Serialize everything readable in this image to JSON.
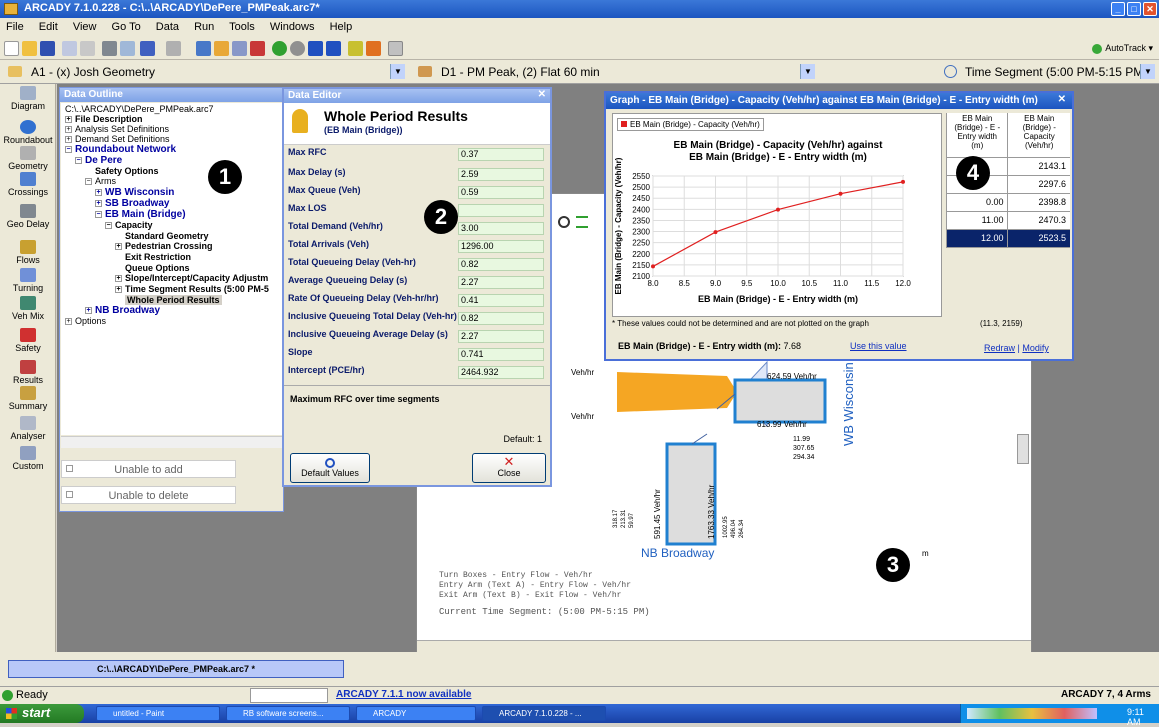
{
  "window": {
    "title": "ARCADY 7.1.0.228 - C:\\..\\ARCADY\\DePere_PMPeak.arc7*"
  },
  "menu": [
    "File",
    "Edit",
    "View",
    "Go To",
    "Data",
    "Run",
    "Tools",
    "Windows",
    "Help"
  ],
  "toolbar": {
    "autotrack": "AutoTrack"
  },
  "selectors": {
    "analysis": "A1 - (x) Josh Geometry",
    "demand": "D1 - PM Peak, (2) Flat 60 min",
    "time": "Time Segment (5:00 PM-5:15 PM)"
  },
  "leftbar": [
    "Diagram",
    "Roundabout",
    "Geometry",
    "Crossings",
    "Geo Delay",
    "Flows",
    "Turning",
    "Veh Mix",
    "Safety",
    "Results",
    "Summary",
    "Analyser",
    "Custom"
  ],
  "outline": {
    "title": "Data Outline",
    "path": "C:\\..\\ARCADY\\DePere_PMPeak.arc7",
    "items": [
      "File Description",
      "Analysis Set Definitions",
      "Demand Set Definitions",
      "Roundabout Network",
      "De Pere",
      "Safety Options",
      "Arms",
      "WB Wisconsin",
      "SB Broadway",
      "EB Main (Bridge)",
      "Capacity",
      "Standard Geometry",
      "Pedestrian Crossing",
      "Exit Restriction",
      "Queue Options",
      "Slope/Intercept/Capacity Adjustm",
      "Time Segment Results (5:00 PM-5",
      "Whole Period Results",
      "NB Broadway",
      "Options"
    ],
    "unable_add": "Unable to add",
    "unable_delete": "Unable to delete"
  },
  "editor": {
    "title": "Data Editor",
    "heading": "Whole Period Results",
    "subheading": "(EB Main (Bridge))",
    "rows": [
      {
        "label": "Max RFC",
        "value": "0.37"
      },
      {
        "label": "Max Delay (s)",
        "value": "2.59"
      },
      {
        "label": "Max Queue (Veh)",
        "value": "0.59"
      },
      {
        "label": "Max LOS",
        "value": ""
      },
      {
        "label": "Total Demand (Veh/hr)",
        "value": "3.00"
      },
      {
        "label": "Total Arrivals (Veh)",
        "value": "1296.00"
      },
      {
        "label": "Total Queueing Delay (Veh-hr)",
        "value": "0.82"
      },
      {
        "label": "Average Queueing Delay (s)",
        "value": "2.27"
      },
      {
        "label": "Rate Of Queueing Delay (Veh-hr/hr)",
        "value": "0.41"
      },
      {
        "label": "Inclusive Queueing Total Delay (Veh-hr)",
        "value": "0.82"
      },
      {
        "label": "Inclusive Queueing Average Delay (s)",
        "value": "2.27"
      },
      {
        "label": "Slope",
        "value": "0.741"
      },
      {
        "label": "Intercept (PCE/hr)",
        "value": "2464.932"
      }
    ],
    "desc": "Maximum RFC over time segments",
    "default": "Default: 1",
    "default_btn": "Default Values",
    "close_btn": "Close"
  },
  "diagram": {
    "flows": [
      "624.59 Veh/hr",
      "613.99 Veh/hr",
      "591.45 Veh/hr",
      "1763.33 Veh/hr"
    ],
    "small": [
      "11.99",
      "307.65",
      "294.34",
      "318.17",
      "213.31",
      "59.97",
      "1002.95",
      "496.04",
      "264.34"
    ],
    "wb": "WB Wisconsin",
    "nb": "NB Broadway",
    "vh": "Veh/hr",
    "legend": [
      "Turn Boxes - Entry Flow - Veh/hr",
      "Entry Arm (Text A) - Entry Flow - Veh/hr",
      "Exit Arm (Text B) - Exit Flow - Veh/hr"
    ],
    "segment": "Current Time Segment: (5:00 PM-5:15 PM)",
    "m": "m"
  },
  "graph": {
    "title": "Graph - EB Main (Bridge) - Capacity (Veh/hr) against EB Main (Bridge) - E - Entry width (m)",
    "legend": "EB Main (Bridge) - Capacity (Veh/hr)",
    "note": "* These values could not be determined and are not plotted on the graph",
    "coords": "(11.3, 2159)",
    "entry_label": "EB Main (Bridge) - E - Entry width (m):",
    "entry_value": "7.68",
    "use": "Use this value",
    "redraw": "Redraw",
    "modify": "Modify",
    "col1": "EB Main (Bridge) - E - Entry width (m)",
    "col2": "EB Main (Bridge) - Capacity (Veh/hr)",
    "table": [
      [
        "",
        "2143.1"
      ],
      [
        "",
        "2297.6"
      ],
      [
        "0.00",
        "2398.8"
      ],
      [
        "11.00",
        "2470.3"
      ],
      [
        "12.00",
        "2523.5"
      ]
    ]
  },
  "chart_data": {
    "type": "line",
    "title": "EB Main (Bridge) - Capacity (Veh/hr) against EB Main (Bridge) - E - Entry width (m)",
    "xlabel": "EB Main (Bridge) - E - Entry width (m)",
    "ylabel": "EB Main (Bridge) - Capacity (Veh/hr)",
    "xlim": [
      8.0,
      12.0
    ],
    "ylim": [
      2100,
      2550
    ],
    "xticks": [
      "8.0",
      "8.5",
      "9.0",
      "9.5",
      "10.0",
      "10.5",
      "11.0",
      "11.5",
      "12.0"
    ],
    "yticks": [
      "2100",
      "2150",
      "2200",
      "2250",
      "2300",
      "2350",
      "2400",
      "2450",
      "2500",
      "2550"
    ],
    "series": [
      {
        "name": "EB Main (Bridge) - Capacity (Veh/hr)",
        "x": [
          8,
          9,
          10,
          11,
          12
        ],
        "y": [
          2143.1,
          2297.6,
          2398.8,
          2470.3,
          2523.5
        ]
      }
    ]
  },
  "badges": [
    "1",
    "2",
    "3",
    "4"
  ],
  "status": {
    "file": "C:\\..\\ARCADY\\DePere_PMPeak.arc7 *",
    "ready": "Ready",
    "update": "ARCADY 7.1.1 now available",
    "right": "ARCADY 7, 4 Arms"
  },
  "taskbar": {
    "start": "start",
    "tasks": [
      "untitled - Paint",
      "RB software screens...",
      "ARCADY",
      "ARCADY 7.1.0.228 - ..."
    ],
    "time": "9:11 AM"
  }
}
